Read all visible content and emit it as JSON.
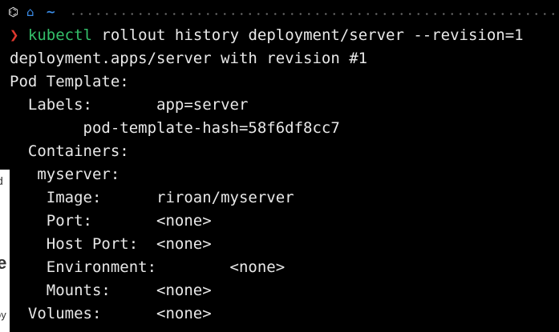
{
  "prompt": {
    "git_icon": "⌬",
    "home_icon": "⌂",
    "path": "~"
  },
  "command": {
    "arrow": "❯",
    "program": "kubectl",
    "args": " rollout history deployment/server --revision=1"
  },
  "output": [
    "deployment.apps/server with revision #1",
    "Pod Template:",
    "  Labels:       app=server",
    "        pod-template-hash=58f6df8cc7",
    "  Containers:",
    "   myserver:",
    "    Image:      riroan/myserver",
    "    Port:       <none>",
    "    Host Port:  <none>",
    "    Environment:        <none>",
    "    Mounts:     <none>",
    "  Volumes:      <none>"
  ],
  "background_strip": {
    "fragments": [
      "d",
      "le",
      "oy"
    ]
  },
  "colors": {
    "background": "#000000",
    "text": "#e8e8e8",
    "arrow": "#e0382e",
    "command": "#34c06a",
    "home_icon": "#3b8eea",
    "git_icon": "#f0f0f0"
  }
}
